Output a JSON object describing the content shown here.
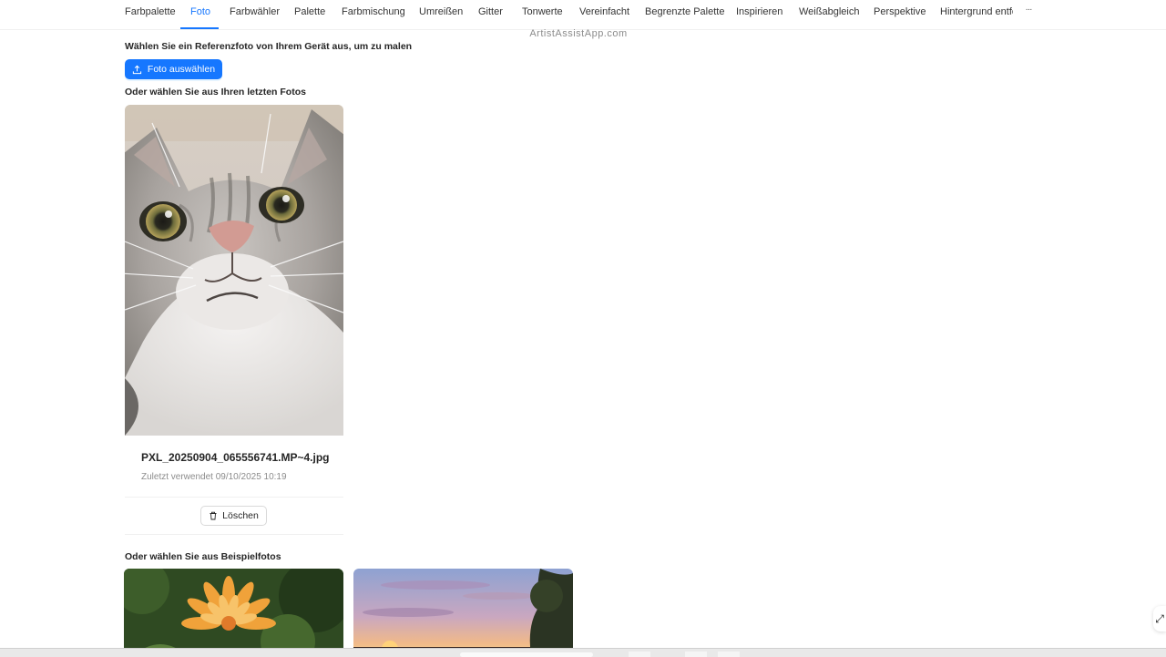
{
  "tabs": [
    {
      "label": "Farbpalette"
    },
    {
      "label": "Foto",
      "active": true
    },
    {
      "label": "Farbwähler"
    },
    {
      "label": "Palette"
    },
    {
      "label": "Farbmischung"
    },
    {
      "label": "Umreißen"
    },
    {
      "label": "Gitter"
    },
    {
      "label": "Tonwerte"
    },
    {
      "label": "Vereinfacht"
    },
    {
      "label": "Begrenzte Palette"
    },
    {
      "label": "Inspirieren"
    },
    {
      "label": "Weißabgleich"
    },
    {
      "label": "Perspektive"
    },
    {
      "label": "Hintergrund entfe"
    }
  ],
  "tabs_more_label": "···",
  "site_title": "ArtistAssistApp.com",
  "main": {
    "select_heading": "Wählen Sie ein Referenzfoto von Ihrem Gerät aus, um zu malen",
    "select_button_label": "Foto auswählen",
    "recent_heading": "Oder wählen Sie aus Ihren letzten Fotos",
    "recent_photos": [
      {
        "filename": "PXL_20250904_065556741.MP~4.jpg",
        "last_used": "Zuletzt verwendet 09/10/2025 10:19",
        "delete_label": "Löschen"
      }
    ],
    "sample_heading": "Oder wählen Sie aus Beispielfotos"
  },
  "colors": {
    "accent": "#1677ff",
    "text": "#262626",
    "muted": "#8c8c8c"
  },
  "icons": {
    "upload": "upload-icon",
    "delete": "trash-icon",
    "more": "ellipsis-icon"
  }
}
